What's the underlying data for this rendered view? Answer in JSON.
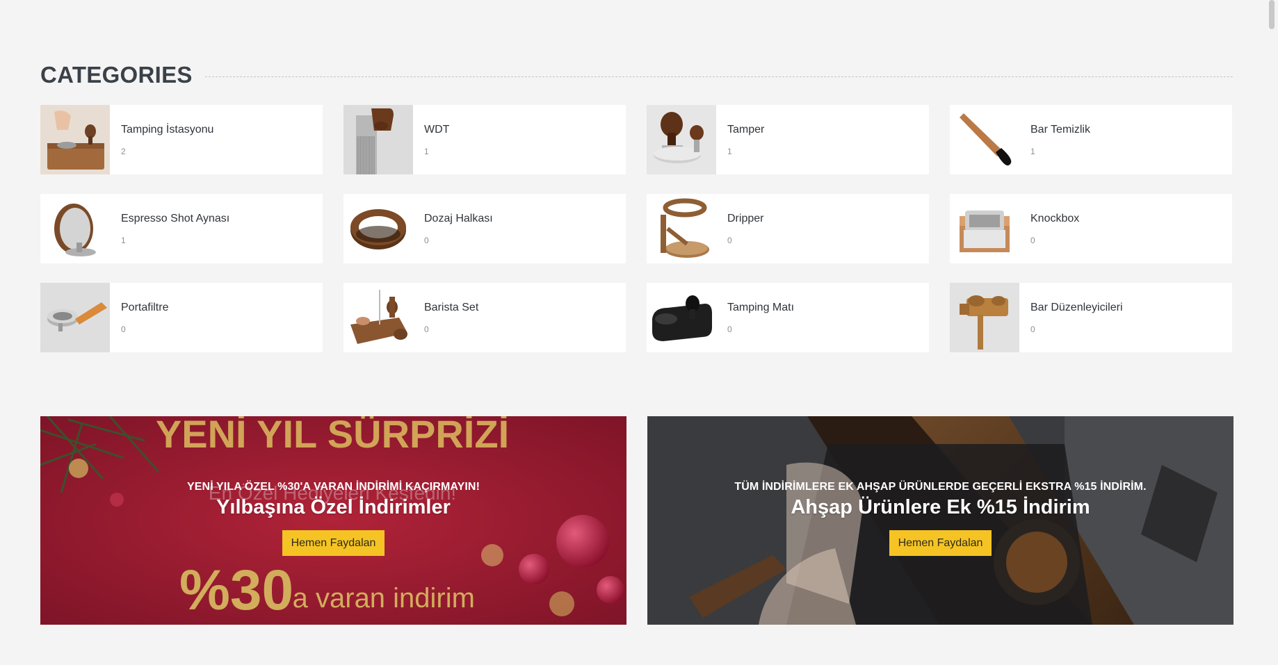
{
  "section": {
    "title": "CATEGORIES"
  },
  "categories": [
    {
      "name": "Tamping İstasyonu",
      "count": "2",
      "icon": "tamping-station-image",
      "grey": false
    },
    {
      "name": "WDT",
      "count": "1",
      "icon": "wdt-tool-image",
      "grey": true
    },
    {
      "name": "Tamper",
      "count": "1",
      "icon": "tamper-image",
      "grey": true
    },
    {
      "name": "Bar Temizlik",
      "count": "1",
      "icon": "cleaning-brush-image",
      "grey": false
    },
    {
      "name": "Espresso Shot Aynası",
      "count": "1",
      "icon": "shot-mirror-image",
      "grey": false
    },
    {
      "name": "Dozaj Halkası",
      "count": "0",
      "icon": "dosing-ring-image",
      "grey": false
    },
    {
      "name": "Dripper",
      "count": "0",
      "icon": "dripper-stand-image",
      "grey": false
    },
    {
      "name": "Knockbox",
      "count": "0",
      "icon": "knockbox-image",
      "grey": false
    },
    {
      "name": "Portafiltre",
      "count": "0",
      "icon": "portafilter-image",
      "grey": true
    },
    {
      "name": "Barista Set",
      "count": "0",
      "icon": "barista-set-image",
      "grey": false
    },
    {
      "name": "Tamping Matı",
      "count": "0",
      "icon": "tamping-mat-image",
      "grey": false
    },
    {
      "name": "Bar Düzenleyicileri",
      "count": "0",
      "icon": "bar-organizer-image",
      "grey": true
    }
  ],
  "banners": [
    {
      "kicker": "YENİ YILA ÖZEL %30'A VARAN İNDİRİMİ KAÇIRMAYIN!",
      "title": "Yılbaşına Özel İndirimler",
      "button": "Hemen Faydalan",
      "image_text": {
        "headline": "YENİ YIL SÜRPRİZİ",
        "sub": "En Özel Hediyeleri Keşfedin!",
        "percent": "%30",
        "tail": "'a varan indirim"
      }
    },
    {
      "kicker": "TÜM İNDİRİMLERE EK AHŞAP ÜRÜNLERDE GEÇERLİ EKSTRA %15 İNDİRİM.",
      "title": "Ahşap Ürünlere Ek %15 İndirim",
      "button": "Hemen Faydalan"
    }
  ],
  "colors": {
    "accent": "#f5c424",
    "page_bg": "#f4f4f4",
    "banner_red": "#9a1c32",
    "banner_dark": "#2c2d30"
  }
}
